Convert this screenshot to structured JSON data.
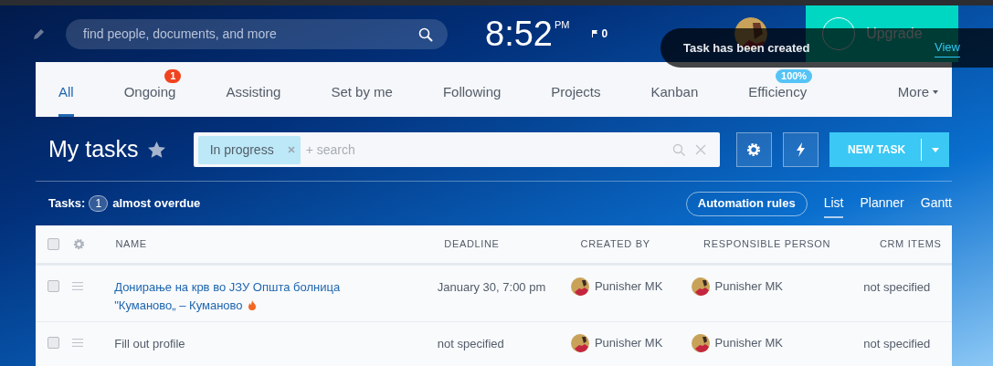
{
  "header": {
    "search": {
      "placeholder": "find people, documents, and more"
    },
    "clock": {
      "time": "8:52",
      "ampm": "PM"
    },
    "flags": "0",
    "upgrade": "Upgrade"
  },
  "toast": {
    "message": "Task has been created",
    "link": "View"
  },
  "tabs": [
    {
      "label": "All",
      "selected": true
    },
    {
      "label": "Ongoing",
      "selected": false,
      "badge": {
        "text": "1",
        "color": "#f0441f"
      }
    },
    {
      "label": "Assisting",
      "selected": false
    },
    {
      "label": "Set by me",
      "selected": false
    },
    {
      "label": "Following",
      "selected": false
    },
    {
      "label": "Projects",
      "selected": false
    },
    {
      "label": "Kanban",
      "selected": false
    },
    {
      "label": "Efficiency",
      "selected": false,
      "badge": {
        "text": "100%",
        "color": "#55c3f5"
      }
    },
    {
      "label": "More",
      "selected": false,
      "dropdown": true
    }
  ],
  "title": "My tasks",
  "favorite": false,
  "filter": {
    "chip": "In progress",
    "placeholder": "+ search"
  },
  "new_task": "NEW TASK",
  "counter": {
    "prefix": "Tasks:",
    "count": "1",
    "suffix": "almost overdue"
  },
  "automation": "Automation rules",
  "views": [
    {
      "label": "List",
      "selected": true
    },
    {
      "label": "Planner",
      "selected": false
    },
    {
      "label": "Gantt",
      "selected": false
    }
  ],
  "table": {
    "select_all": false,
    "columns": [
      "NAME",
      "DEADLINE",
      "CREATED BY",
      "RESPONSIBLE PERSON",
      "CRM ITEMS"
    ],
    "rows": [
      {
        "checked": false,
        "name": "Донирање на крв во ЈЗУ Општа болница \"Куманово„ – Куманово",
        "hot": true,
        "deadline": "January 30, 7:00 pm",
        "created_by": "Punisher MK",
        "responsible": "Punisher MK",
        "crm": "not specified"
      },
      {
        "checked": false,
        "name": "Fill out profile",
        "hot": false,
        "deadline": "not specified",
        "created_by": "Punisher MK",
        "responsible": "Punisher MK",
        "crm": "not specified"
      }
    ]
  }
}
